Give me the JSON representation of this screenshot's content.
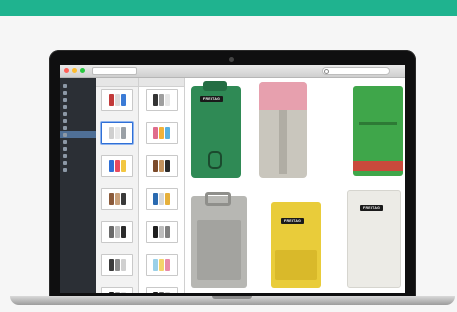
{
  "colors": {
    "top_band": "#1fb38f",
    "sidebar_bg": "#2b2f35",
    "selection": "#2f6fd6"
  },
  "titlebar": {
    "address": "",
    "title": "",
    "search_placeholder": ""
  },
  "sidebar": {
    "items": [
      {
        "label": "",
        "icon": "folder-icon"
      },
      {
        "label": "",
        "icon": "folder-icon"
      },
      {
        "label": "",
        "icon": "folder-icon"
      },
      {
        "label": "",
        "icon": "folder-icon"
      },
      {
        "label": "",
        "icon": "folder-icon"
      },
      {
        "label": "",
        "icon": "folder-icon"
      },
      {
        "label": "",
        "icon": "folder-icon"
      },
      {
        "label": "",
        "icon": "folder-icon",
        "selected": true
      },
      {
        "label": "",
        "icon": "folder-icon"
      },
      {
        "label": "",
        "icon": "folder-icon"
      },
      {
        "label": "",
        "icon": "folder-icon"
      },
      {
        "label": "",
        "icon": "folder-icon"
      },
      {
        "label": "",
        "icon": "folder-icon"
      }
    ]
  },
  "column1": {
    "items": [
      {
        "caption": "",
        "colors": [
          "#c23b3b",
          "#dcdcdc",
          "#3b7bd6"
        ]
      },
      {
        "caption": "",
        "colors": [
          "#cfcfcf",
          "#e8e8e8",
          "#9aa0a6"
        ],
        "selected": true
      },
      {
        "caption": "",
        "colors": [
          "#2f6fd6",
          "#e84a5f",
          "#f2c641"
        ]
      },
      {
        "caption": "",
        "colors": [
          "#8a5a3a",
          "#c8a07a",
          "#3a3a3a"
        ]
      },
      {
        "caption": "",
        "colors": [
          "#6a6a6a",
          "#bdbdbd",
          "#2b2b2b"
        ]
      },
      {
        "caption": "",
        "colors": [
          "#3b3b3b",
          "#8c8c8c",
          "#d0d0d0"
        ]
      },
      {
        "caption": "",
        "colors": [
          "#1f1f1f",
          "#a8a8a8",
          "#e0e0e0"
        ]
      }
    ]
  },
  "column2": {
    "items": [
      {
        "caption": "",
        "colors": [
          "#333333",
          "#9e9e9e",
          "#e6e6e6"
        ]
      },
      {
        "caption": "",
        "colors": [
          "#e06c8c",
          "#f0b23a",
          "#58b0e0"
        ]
      },
      {
        "caption": "",
        "colors": [
          "#7b4a2a",
          "#c4935e",
          "#2a2a2a"
        ]
      },
      {
        "caption": "",
        "colors": [
          "#2a6ab0",
          "#d8d8d8",
          "#e6b03a"
        ]
      },
      {
        "caption": "",
        "colors": [
          "#1e1e1e",
          "#bcbcbc",
          "#7f7f7f"
        ]
      },
      {
        "caption": "",
        "colors": [
          "#9ad0e8",
          "#f3d36b",
          "#e88aa8"
        ]
      },
      {
        "caption": "",
        "colors": [
          "#1f1f1f",
          "#6c6c6c",
          "#cfcfcf"
        ]
      }
    ]
  },
  "preview": {
    "brand_tag": "FREITAG",
    "wallets": [
      {
        "name": "green-phone-case",
        "color": "#2f8a55"
      },
      {
        "name": "grey-pink-case",
        "color": "#c9c6bd"
      },
      {
        "name": "green-red-case",
        "color": "#3fa64a"
      },
      {
        "name": "grey-clip-case",
        "color": "#b7b7b3"
      },
      {
        "name": "yellow-case",
        "color": "#e9cc3a"
      },
      {
        "name": "white-case",
        "color": "#ecebe6"
      }
    ]
  }
}
